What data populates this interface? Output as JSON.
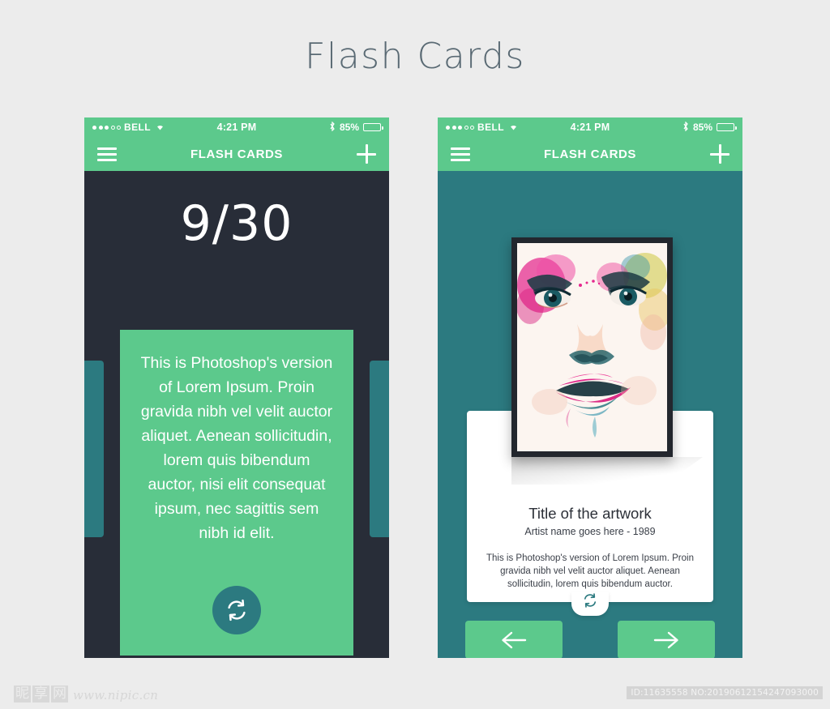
{
  "page": {
    "title": "Flash Cards",
    "background_color": "#ececec"
  },
  "colors": {
    "green": "#5cc98c",
    "teal": "#2c7a80",
    "dark": "#282d38",
    "white": "#ffffff",
    "title_text": "#5a6a74"
  },
  "status_bar": {
    "carrier": "BELL",
    "signal_filled_dots": 3,
    "signal_hollow_dots": 2,
    "wifi_icon": "wifi-icon",
    "time": "4:21 PM",
    "bluetooth_icon": "bluetooth-icon",
    "battery_percent": "85%",
    "battery_icon": "battery-icon"
  },
  "nav_bar": {
    "menu_icon": "hamburger-menu-icon",
    "title": "FLASH CARDS",
    "add_icon": "plus-icon"
  },
  "screen_one": {
    "counter": "9/30",
    "card_text": "This is Photoshop's version  of Lorem Ipsum. Proin gravida nibh vel velit auctor aliquet. Aenean sollicitudin, lorem quis bibendum auctor, nisi elit consequat ipsum, nec sagittis sem nibh id elit.",
    "flip_icon": "refresh-flip-icon"
  },
  "screen_two": {
    "artwork_alt": "watercolor-portrait-artwork",
    "art_title": "Title of the artwork",
    "art_artist": "Artist name goes here - 1989",
    "art_description": "This is Photoshop's version  of Lorem Ipsum. Proin gravida nibh vel velit auctor aliquet. Aenean sollicitudin, lorem quis bibendum auctor.",
    "flip_icon": "refresh-flip-icon",
    "prev_icon": "arrow-left-icon",
    "next_icon": "arrow-right-icon"
  },
  "footer": {
    "logo_chars": [
      "昵",
      "享",
      "网"
    ],
    "site_url": "www.nipic.cn",
    "id_text": "ID:11635558 NO:20190612154247093000"
  }
}
